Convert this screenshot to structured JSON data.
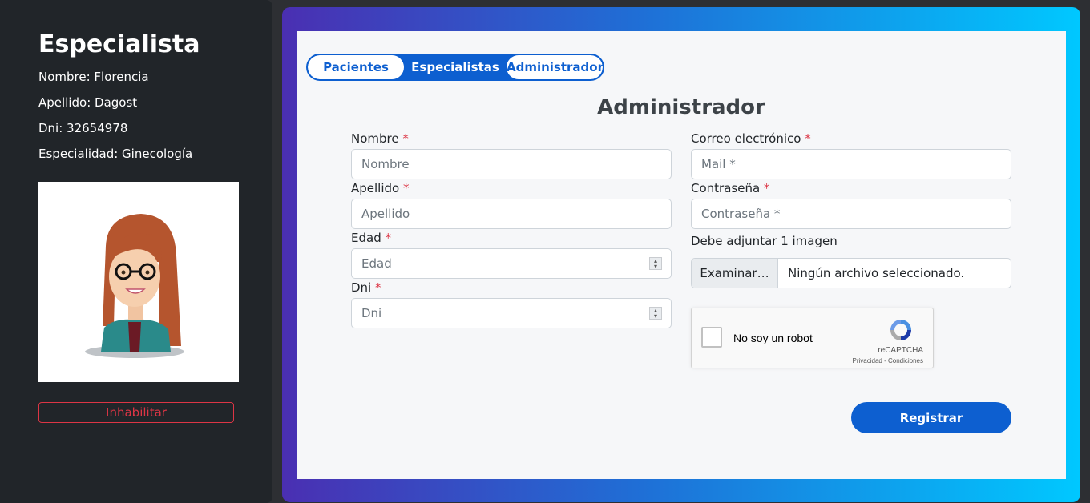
{
  "sidebar": {
    "title": "Especialista",
    "fields": [
      "Nombre: Florencia",
      "Apellido: Dagost",
      "Dni: 32654978",
      "Especialidad: Ginecología"
    ],
    "disable_label": "Inhabilitar"
  },
  "tabs": {
    "pacientes": "Pacientes",
    "especialistas": "Especialistas",
    "administrador": "Administrador"
  },
  "form": {
    "title": "Administrador",
    "required_mark": "*",
    "nombre_label": "Nombre",
    "nombre_placeholder": "Nombre",
    "apellido_label": "Apellido",
    "apellido_placeholder": "Apellido",
    "edad_label": "Edad",
    "edad_placeholder": "Edad",
    "dni_label": "Dni",
    "dni_placeholder": "Dni",
    "email_label": "Correo electrónico",
    "email_placeholder": "Mail *",
    "password_label": "Contraseña",
    "password_placeholder": "Contraseña *",
    "image_label": "Debe adjuntar 1 imagen",
    "file_button": "Examinar…",
    "file_status": "Ningún archivo seleccionado.",
    "captcha_label": "No soy un robot",
    "captcha_brand": "reCAPTCHA",
    "captcha_links": "Privacidad - Condiciones",
    "submit_label": "Registrar"
  },
  "colors": {
    "primary": "#0d5fd0",
    "danger": "#dc3545",
    "sidebar_bg": "#212529",
    "gradient_start": "#4a2fb2",
    "gradient_end": "#00c8ff"
  }
}
